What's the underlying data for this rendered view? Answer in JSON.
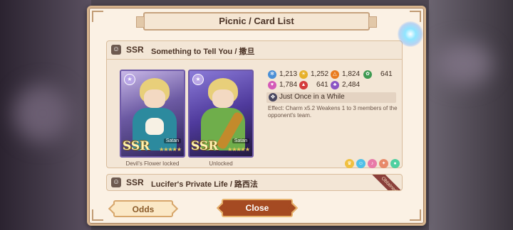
{
  "dialog": {
    "title": "Picnic / Card List"
  },
  "featured_card": {
    "rarity": "SSR",
    "name": "Something to Tell You / 撒旦",
    "variants": [
      {
        "caption": "Devil's Flower locked",
        "art_label": "SSR",
        "character": "Satan"
      },
      {
        "caption": "Unlocked",
        "art_label": "SSR",
        "character": "Satan"
      }
    ],
    "stats": [
      {
        "value": "1,213",
        "icon": "pride-icon",
        "color": "#4a8fd6"
      },
      {
        "value": "1,252",
        "icon": "sun-icon",
        "color": "#e6b02a"
      },
      {
        "value": "1,824",
        "icon": "flame-icon",
        "color": "#e97b1e"
      },
      {
        "value": "641",
        "icon": "leaf-icon",
        "color": "#3e9a52"
      },
      {
        "value": "1,784",
        "icon": "heart-icon",
        "color": "#d45ab8"
      },
      {
        "value": "641",
        "icon": "dragon-icon",
        "color": "#d43c3c"
      },
      {
        "value": "2,484",
        "icon": "symbol-icon",
        "color": "#8b56c4"
      }
    ],
    "skill": {
      "name": "Just Once in a While",
      "effect": "Effect: Charm x5.2 Weakens 1 to 3 members of the opponent's team."
    },
    "mini_icons": [
      {
        "icon": "crown-icon",
        "color": "#f0c040"
      },
      {
        "icon": "face-icon",
        "color": "#4fc0e8"
      },
      {
        "icon": "note-icon",
        "color": "#e87aa8"
      },
      {
        "icon": "wand-icon",
        "color": "#e88a6a"
      },
      {
        "icon": "chat-icon",
        "color": "#4fd0a0"
      }
    ]
  },
  "second_card": {
    "rarity": "SSR",
    "name": "Lucifer's Private Life / 路西法",
    "ribbon": "Obtained"
  },
  "buttons": {
    "odds": "Odds",
    "close": "Close"
  }
}
